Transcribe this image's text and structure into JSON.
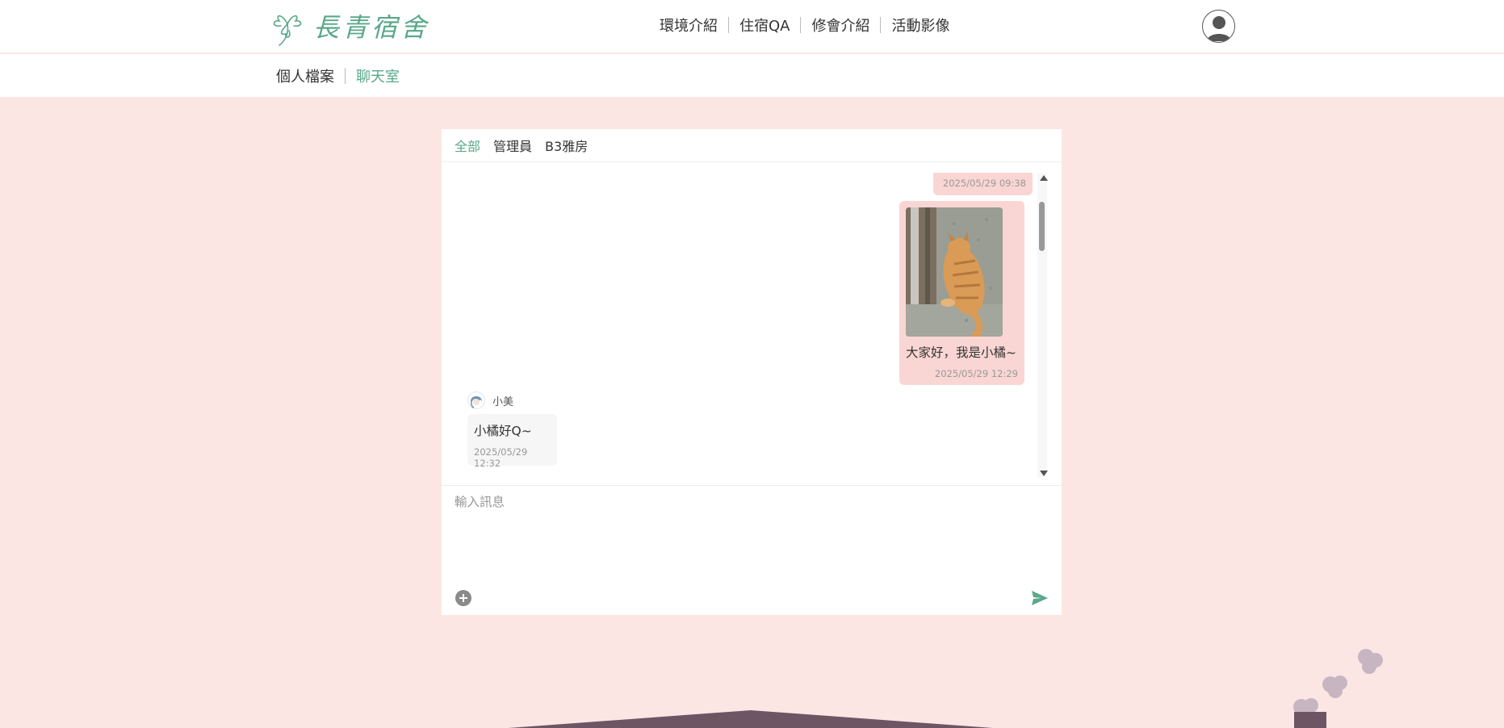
{
  "site": {
    "logo_text": "長青宿舍"
  },
  "main_nav": [
    {
      "label": "環境介紹"
    },
    {
      "label": "住宿QA"
    },
    {
      "label": "修會介紹"
    },
    {
      "label": "活動影像"
    }
  ],
  "sub_nav": [
    {
      "label": "個人檔案",
      "active": false
    },
    {
      "label": "聊天室",
      "active": true
    }
  ],
  "chat": {
    "tabs": [
      {
        "label": "全部",
        "active": true
      },
      {
        "label": "管理員",
        "active": false
      },
      {
        "label": "B3雅房",
        "active": false
      }
    ],
    "messages": [
      {
        "from": "me",
        "time": "2025/05/29 09:38"
      },
      {
        "from": "me",
        "has_image": true,
        "image_icon": "orange-cat-photo",
        "text": "大家好，我是小橘~",
        "time": "2025/05/29 12:29"
      },
      {
        "from": "other",
        "sender": "小美",
        "text": "小橘好Q~",
        "time": "2025/05/29 12:32"
      }
    ],
    "input_placeholder": "輸入訊息"
  },
  "colors": {
    "accent": "#5aa88a",
    "background": "#fce6e4",
    "my_bubble": "#f9d6d3",
    "other_bubble": "#f6f6f6",
    "roof": "#6d5563"
  }
}
